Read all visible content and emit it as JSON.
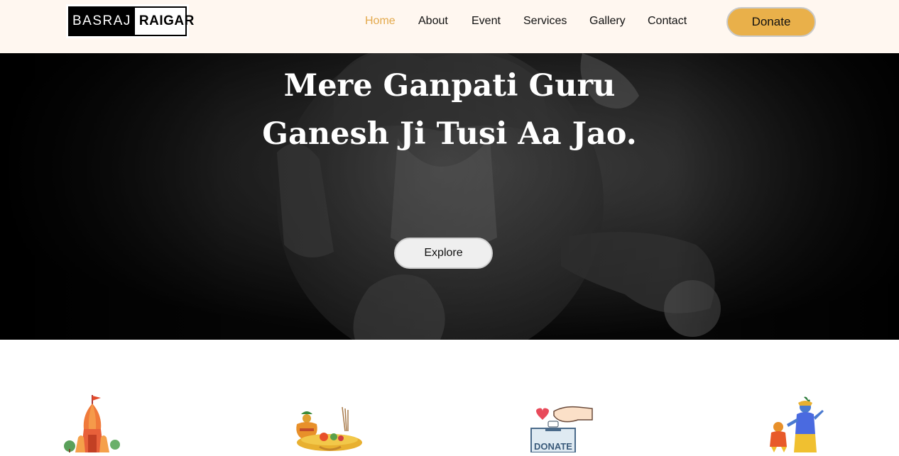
{
  "brand": {
    "logo_left": "BASRAJ",
    "logo_right": "RAIGAR"
  },
  "nav": {
    "items": [
      {
        "label": "Home",
        "active": true
      },
      {
        "label": "About",
        "active": false
      },
      {
        "label": "Event",
        "active": false
      },
      {
        "label": "Services",
        "active": false
      },
      {
        "label": "Gallery",
        "active": false
      },
      {
        "label": "Contact",
        "active": false
      }
    ],
    "donate_label": "Donate"
  },
  "hero": {
    "title_line1": "Mere Ganpati Guru",
    "title_line2": "Ganesh Ji Tusi Aa Jao.",
    "explore_label": "Explore",
    "background_icon": "ganesha-statue-photo"
  },
  "features": [
    {
      "icon": "temple-icon"
    },
    {
      "icon": "puja-kalash-icon"
    },
    {
      "icon": "donation-box-icon",
      "label": "DONATE"
    },
    {
      "icon": "krishna-hanuman-icon"
    }
  ],
  "colors": {
    "header_bg": "#fff7f0",
    "accent": "#e9b04a",
    "active_nav": "#e3a94c"
  }
}
